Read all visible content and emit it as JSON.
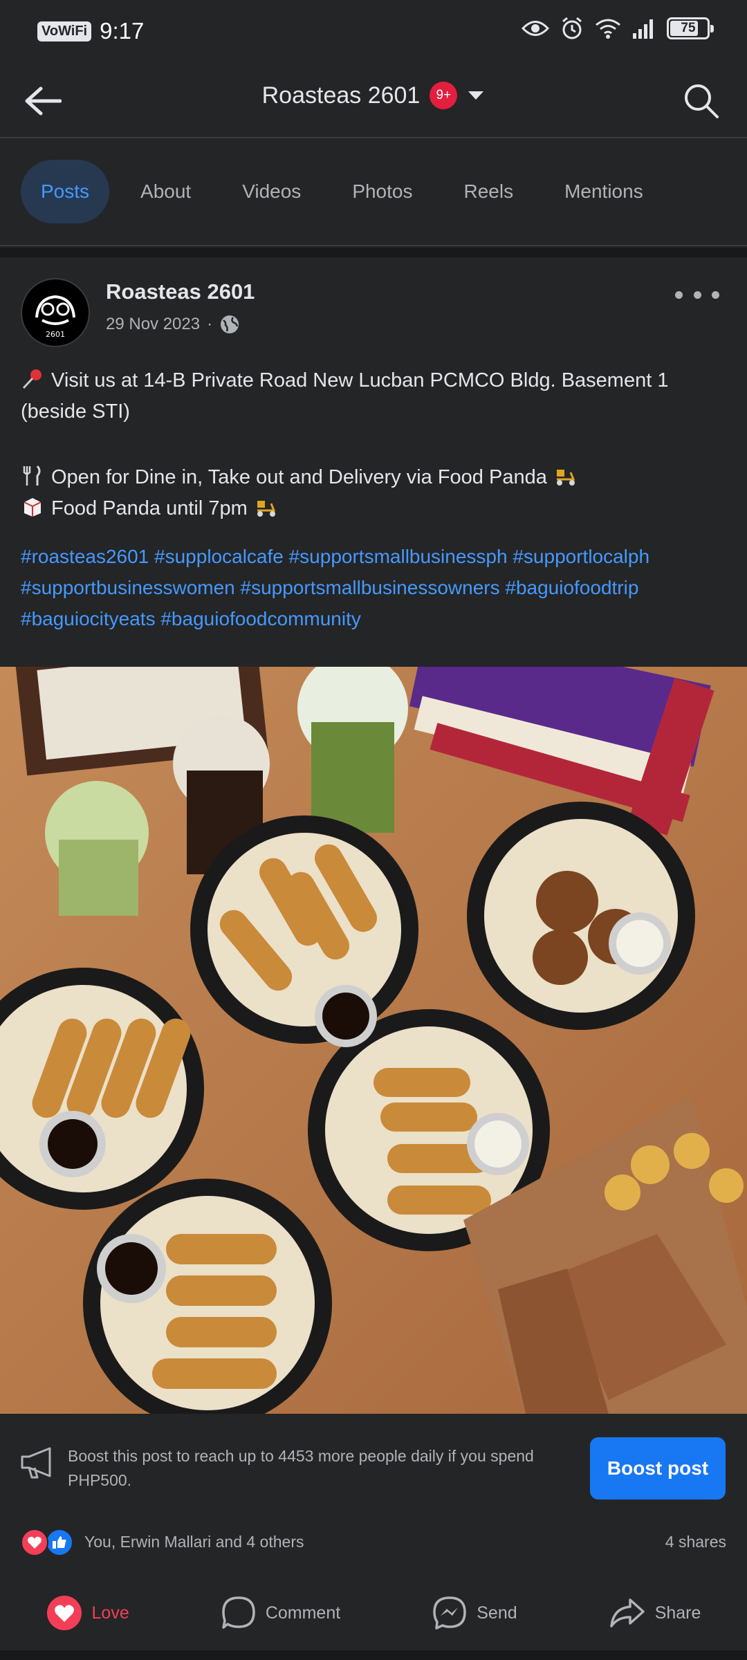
{
  "status_bar": {
    "carrier_badge": "VoWiFi",
    "time": "9:17",
    "battery": "75"
  },
  "header": {
    "title": "Roasteas 2601",
    "notification_badge": "9+"
  },
  "tabs": [
    {
      "label": "Posts",
      "active": true
    },
    {
      "label": "About",
      "active": false
    },
    {
      "label": "Videos",
      "active": false
    },
    {
      "label": "Photos",
      "active": false
    },
    {
      "label": "Reels",
      "active": false
    },
    {
      "label": "Mentions",
      "active": false
    }
  ],
  "post": {
    "author": "Roasteas 2601",
    "avatar_text": "2601",
    "date": "29 Nov 2023",
    "separator": "·",
    "line1": "Visit us at 14-B Private Road New Lucban PCMCO Bldg. Basement 1 (beside STI)",
    "line2": "Open for Dine in, Take out and Delivery via Food Panda",
    "line3": "Food Panda until 7pm",
    "hashtags": "#roasteas2601 #supplocalcafe #supportsmallbusinessph #supportlocalph #supportbusinesswomen #supportsmallbusinessowners #baguiofoodtrip #baguiocityeats #baguiofoodcommunity"
  },
  "boost": {
    "text": "Boost this post to reach up to 4453 more people daily if you spend PHP500.",
    "button": "Boost post"
  },
  "engagement": {
    "reactions_text": "You, Erwin Mallari and 4 others",
    "shares": "4 shares"
  },
  "actions": {
    "love": "Love",
    "comment": "Comment",
    "send": "Send",
    "share": "Share"
  },
  "colors": {
    "background": "#242526",
    "accent": "#4599ff",
    "boost_button": "#1877f2",
    "love": "#f33e58"
  }
}
